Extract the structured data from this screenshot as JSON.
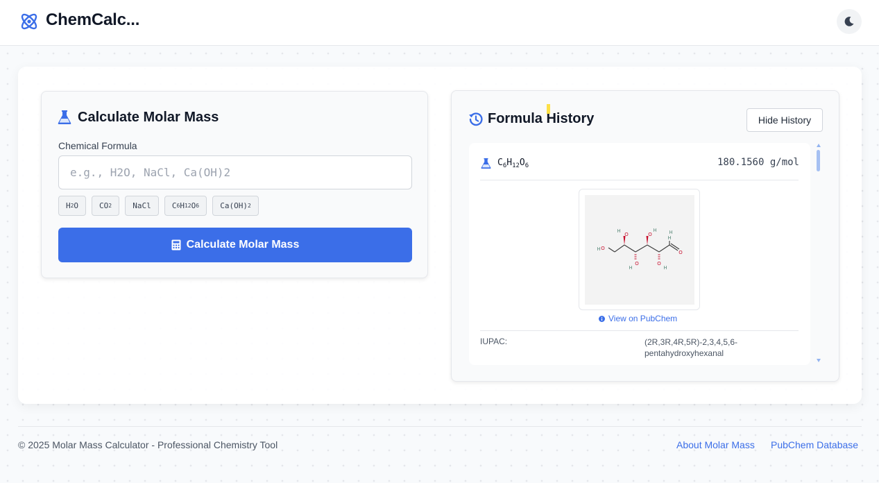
{
  "app": {
    "title": "ChemCalc...",
    "logo_icon": "atom-icon",
    "theme_icon": "moon-icon"
  },
  "calculator": {
    "title": "Calculate Molar Mass",
    "title_icon": "flask-icon",
    "field_label": "Chemical Formula",
    "input_value": "",
    "input_placeholder": "e.g., H2O, NaCl, Ca(OH)2",
    "examples": [
      {
        "text": "H2O",
        "parts": [
          [
            "H",
            ""
          ],
          [
            "2",
            "sub"
          ],
          [
            "O",
            ""
          ]
        ]
      },
      {
        "text": "CO2",
        "parts": [
          [
            "CO",
            ""
          ],
          [
            "2",
            "sub"
          ]
        ]
      },
      {
        "text": "NaCl",
        "parts": [
          [
            "NaCl",
            ""
          ]
        ]
      },
      {
        "text": "C6H12O6",
        "parts": [
          [
            "C",
            ""
          ],
          [
            "6",
            "sub"
          ],
          [
            "H",
            ""
          ],
          [
            "12",
            "sub"
          ],
          [
            "O",
            ""
          ],
          [
            "6",
            "sub"
          ]
        ]
      },
      {
        "text": "Ca(OH)2",
        "parts": [
          [
            "Ca(OH)",
            ""
          ],
          [
            "2",
            "sub"
          ]
        ]
      }
    ],
    "button_label": "Calculate Molar Mass",
    "button_icon": "calculator-icon"
  },
  "history": {
    "title": "Formula History",
    "title_icon": "history-icon",
    "toggle_label": "Hide History",
    "entries": [
      {
        "formula": "C6H12O6",
        "formula_parts": [
          [
            "C",
            ""
          ],
          [
            "6",
            "sub"
          ],
          [
            "H",
            ""
          ],
          [
            "12",
            "sub"
          ],
          [
            "O",
            ""
          ],
          [
            "6",
            "sub"
          ]
        ],
        "mass": "180.1560 g/mol",
        "structure_atoms": [
          "O",
          "H",
          "H",
          "O",
          "H",
          "O",
          "H",
          "O",
          "O",
          "H",
          "H",
          "O",
          "H"
        ],
        "link_label": "View on PubChem",
        "link_icon": "info-icon",
        "iupac_label": "IUPAC:",
        "iupac_value": "(2R,3R,4R,5R)-2,3,4,5,6-pentahydroxyhexanal"
      }
    ]
  },
  "footer": {
    "copyright": "© 2025 Molar Mass Calculator - Professional Chemistry Tool",
    "links": [
      "About Molar Mass",
      "PubChem Database"
    ]
  },
  "colors": {
    "accent": "#3b6ee8",
    "text_dark": "#111827",
    "muted": "#4b5563"
  }
}
